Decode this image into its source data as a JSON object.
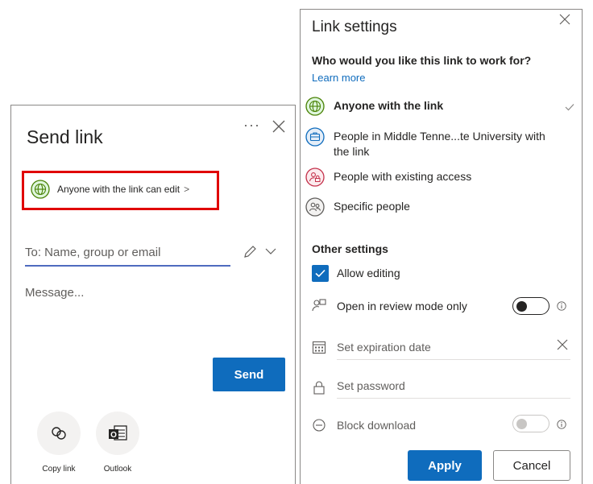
{
  "send_link": {
    "title": "Send link",
    "more_glyph": "···",
    "permission": {
      "label": "Anyone with the link can edit",
      "chevron": ">",
      "icon": "globe-icon"
    },
    "to_placeholder": "To: Name, group or email",
    "message_placeholder": "Message...",
    "send_label": "Send",
    "share_options": [
      {
        "label": "Copy link",
        "icon": "link-icon"
      },
      {
        "label": "Outlook",
        "icon": "outlook-icon"
      }
    ]
  },
  "link_settings": {
    "title": "Link settings",
    "question": "Who would you like this link to work for?",
    "learn_more": "Learn more",
    "options": [
      {
        "label": "Anyone with the link",
        "selected": true,
        "icon": "globe-icon",
        "color": "#498205"
      },
      {
        "label": "People in Middle Tenne...te University with the link",
        "selected": false,
        "icon": "briefcase-icon",
        "color": "#0f6cbd"
      },
      {
        "label": "People with existing access",
        "selected": false,
        "icon": "people-lock-icon",
        "color": "#c4314b"
      },
      {
        "label": "Specific people",
        "selected": false,
        "icon": "people-icon",
        "color": "#605e5c"
      }
    ],
    "other_settings": "Other settings",
    "allow_editing": {
      "label": "Allow editing",
      "checked": true
    },
    "review_mode": {
      "label": "Open in review mode only",
      "on": false
    },
    "expiration": {
      "label": "Set expiration date"
    },
    "password": {
      "label": "Set password"
    },
    "block_download": {
      "label": "Block download",
      "on": false,
      "disabled": true
    },
    "apply_label": "Apply",
    "cancel_label": "Cancel"
  },
  "colors": {
    "accent": "#0f6cbd",
    "highlight": "#e00000"
  }
}
